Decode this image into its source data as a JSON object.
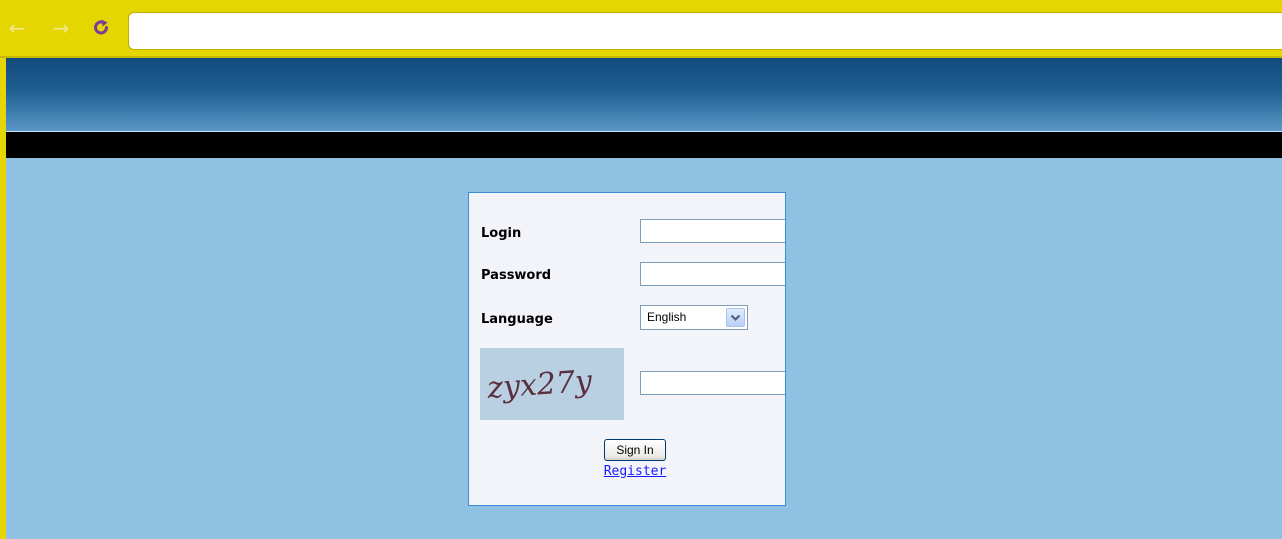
{
  "browser": {
    "back_icon": "back-arrow-icon",
    "forward_icon": "forward-arrow-icon",
    "reload_icon": "reload-icon",
    "url_value": "",
    "toolbar_color": "#e5d500"
  },
  "header": {
    "banner_color": "#1f5f92",
    "nav_bar_color": "#000000"
  },
  "login_form": {
    "login_label": "Login",
    "login_value": "",
    "password_label": "Password",
    "password_value": "",
    "language_label": "Language",
    "language_selected": "English",
    "captcha_text": "zyx27y",
    "captcha_value": "",
    "sign_in_label": "Sign In",
    "register_label": "Register"
  },
  "colors": {
    "page_background": "#8fc1e2",
    "panel_background": "#f3f4fa",
    "panel_border": "#3d8ad8",
    "link": "#1a1aff"
  }
}
